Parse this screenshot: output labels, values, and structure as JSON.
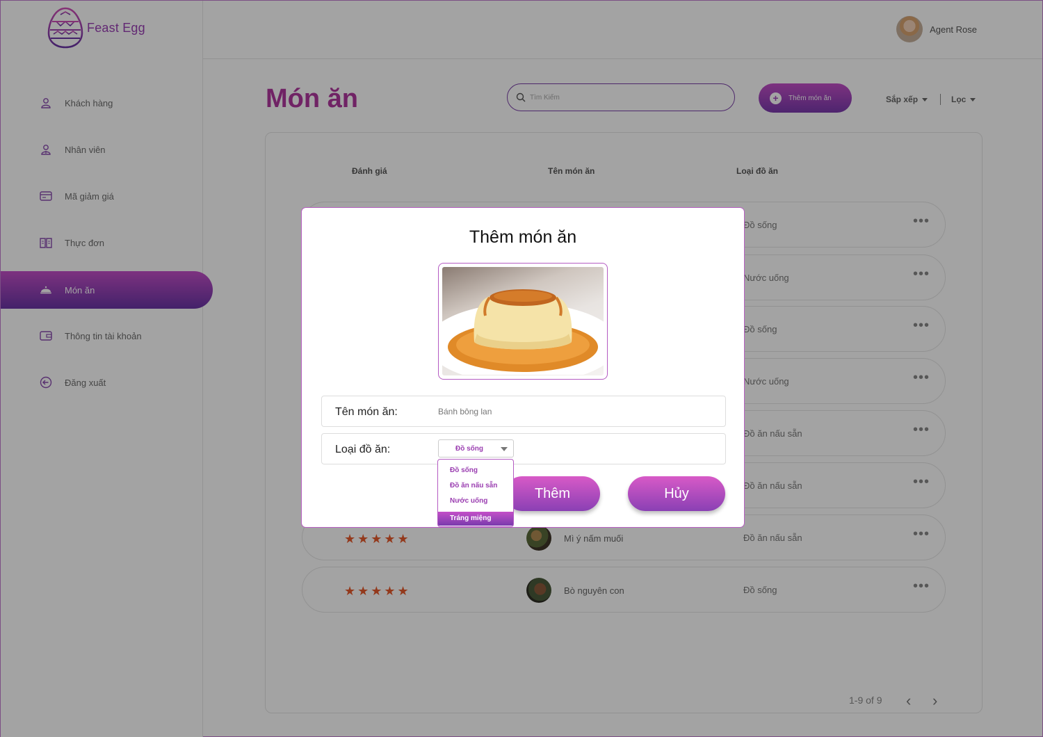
{
  "app": {
    "name": "Feast Egg"
  },
  "user": {
    "name": "Agent Rose"
  },
  "sidebar": {
    "items": [
      {
        "label": "Khách hàng",
        "icon": "user-icon"
      },
      {
        "label": "Nhân viên",
        "icon": "employee-icon"
      },
      {
        "label": "Mã giảm giá",
        "icon": "coupon-icon"
      },
      {
        "label": "Thực đơn",
        "icon": "menu-book-icon"
      },
      {
        "label": "Món ăn",
        "icon": "dish-icon",
        "active": true
      },
      {
        "label": "Thông tin tài khoản",
        "icon": "wallet-icon"
      },
      {
        "label": "Đăng xuất",
        "icon": "logout-icon"
      }
    ]
  },
  "main": {
    "title": "Món ăn",
    "search_placeholder": "Tìm Kiếm",
    "add_button": "Thêm món ăn",
    "sort_label": "Sắp xếp",
    "filter_label": "Lọc",
    "columns": [
      "Đánh giá",
      "Tên món ăn",
      "Loại đồ ăn"
    ],
    "rows": [
      {
        "category": "Đồ sống"
      },
      {
        "category": "Nước uống"
      },
      {
        "category": "Đồ sống"
      },
      {
        "category": "Nước uống"
      },
      {
        "category": "Đồ ăn nấu sẵn"
      },
      {
        "category": "Đồ ăn nấu sẵn"
      },
      {
        "rating": 5,
        "name": "Mì ý nấm muối",
        "category": "Đồ ăn nấu sẵn"
      },
      {
        "rating": 5,
        "name": "Bò nguyên con",
        "category": "Đồ sống"
      }
    ],
    "pagination": "1-9 of 9"
  },
  "modal": {
    "title": "Thêm món ăn",
    "name_label": "Tên món ăn:",
    "name_value": "Bánh bông lan",
    "type_label": "Loại đồ ăn:",
    "type_selected": "Đồ sống",
    "type_options": [
      "Đồ sống",
      "Đồ ăn nấu sẵn",
      "Nước uống",
      "Tráng miệng"
    ],
    "highlighted_option": "Tráng miệng",
    "add_button": "Thêm",
    "cancel_button": "Hủy"
  },
  "colors": {
    "accent": "#b0389f",
    "gradient_top": "#c34fc8",
    "gradient_bottom": "#6a35a6",
    "star": "#e65a2c"
  }
}
